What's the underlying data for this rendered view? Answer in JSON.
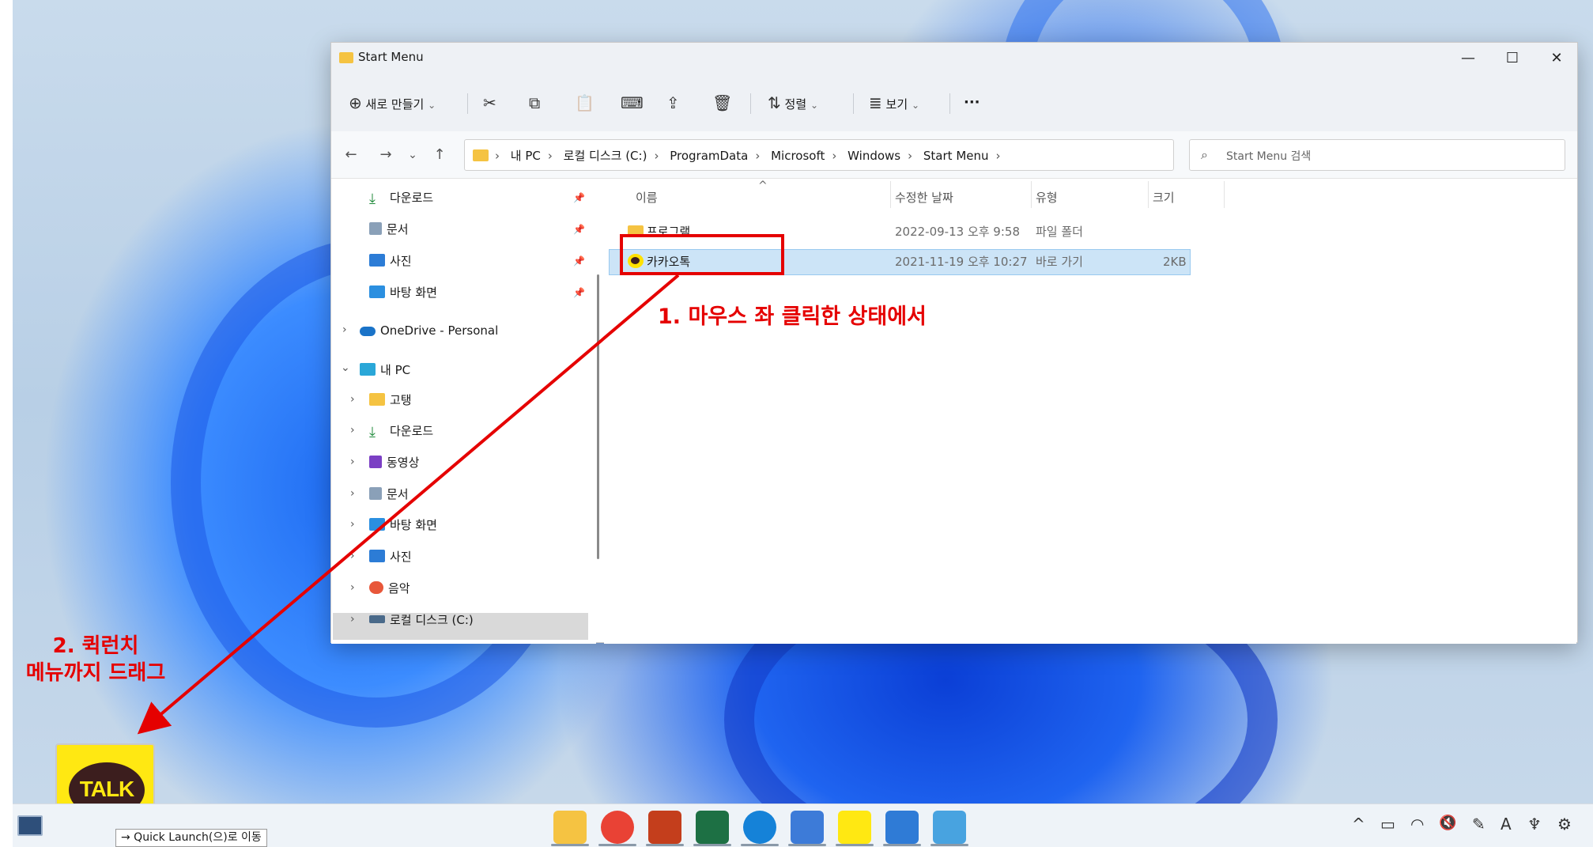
{
  "window": {
    "title": "Start Menu",
    "minimize": "—",
    "maximize": "☐",
    "close": "✕"
  },
  "toolbar": {
    "new_label": "새로 만들기",
    "new_icon": "⊕",
    "cut_icon": "✂",
    "copy_icon": "⧉",
    "paste_icon": "📋",
    "rename_icon": "⌨",
    "share_icon": "⇪",
    "delete_icon": "🗑",
    "sort_label": "정렬",
    "sort_icon": "⇅",
    "view_label": "보기",
    "view_icon": "≣",
    "more_icon": "···",
    "dropdown_caret": "⌄"
  },
  "address": {
    "back": "←",
    "forward": "→",
    "recent": "⌄",
    "up": "↑",
    "crumbs": [
      "내 PC",
      "로컬 디스크 (C:)",
      "ProgramData",
      "Microsoft",
      "Windows",
      "Start Menu"
    ],
    "crumb_sep": "›",
    "dropdown": "⌄",
    "refresh": "↻",
    "search_placeholder": "Start Menu 검색"
  },
  "nav": {
    "quick": [
      {
        "label": "다운로드",
        "color": "#1f8a3b"
      },
      {
        "label": "문서",
        "color": "#8aa0b8"
      },
      {
        "label": "사진",
        "color": "#2c7cd6"
      },
      {
        "label": "바탕 화면",
        "color": "#2b8fe0"
      }
    ],
    "onedrive": "OneDrive - Personal",
    "thispc": "내 PC",
    "pc_items": [
      {
        "label": "고탱",
        "color": "#f5c342"
      },
      {
        "label": "다운로드",
        "color": "#1f8a3b"
      },
      {
        "label": "동영상",
        "color": "#7b3fc4"
      },
      {
        "label": "문서",
        "color": "#8aa0b8"
      },
      {
        "label": "바탕 화면",
        "color": "#2b8fe0"
      },
      {
        "label": "사진",
        "color": "#2c7cd6"
      },
      {
        "label": "음악",
        "color": "#e8573a"
      },
      {
        "label": "로컬 디스크 (C:)",
        "color": "#4a6a8a"
      }
    ],
    "chev_right": "›",
    "chev_down": "⌄",
    "pin": "📌"
  },
  "content": {
    "columns": [
      "이름",
      "수정한 날짜",
      "유형",
      "크기"
    ],
    "sort_caret": "^",
    "rows": [
      {
        "name": "프로그램",
        "date": "2022-09-13 오후 9:58",
        "type": "파일 폴더",
        "size": "",
        "kind": "folder"
      },
      {
        "name": "카카오톡",
        "date": "2021-11-19 오후 10:27",
        "type": "바로 가기",
        "size": "2KB",
        "kind": "shortcut"
      }
    ]
  },
  "annotations": {
    "step1": "1. 마우스 좌 클릭한 상태에서",
    "step2_line1": "2. 퀵런치",
    "step2_line2": "메뉴까지 드래그",
    "arrow_color": "#e50000"
  },
  "drag": {
    "icon_label": "TALK",
    "tooltip": "→ Quick Launch(으)로 이동"
  },
  "taskbar": {
    "apps": [
      {
        "name": "file-explorer",
        "color": "#f5c342"
      },
      {
        "name": "chrome",
        "color": "#e94235"
      },
      {
        "name": "powerpoint",
        "color": "#c43e1c"
      },
      {
        "name": "excel",
        "color": "#1d7044"
      },
      {
        "name": "edge",
        "color": "#1582d8"
      },
      {
        "name": "notepad",
        "color": "#3d7bd8"
      },
      {
        "name": "kakaotalk",
        "color": "#ffe812"
      },
      {
        "name": "photos",
        "color": "#2f7bd6"
      },
      {
        "name": "paint",
        "color": "#48a3e0"
      }
    ],
    "tray": [
      "^",
      "▭",
      "◠",
      "🔇",
      "✎",
      "A",
      "♆",
      "⚙"
    ]
  }
}
